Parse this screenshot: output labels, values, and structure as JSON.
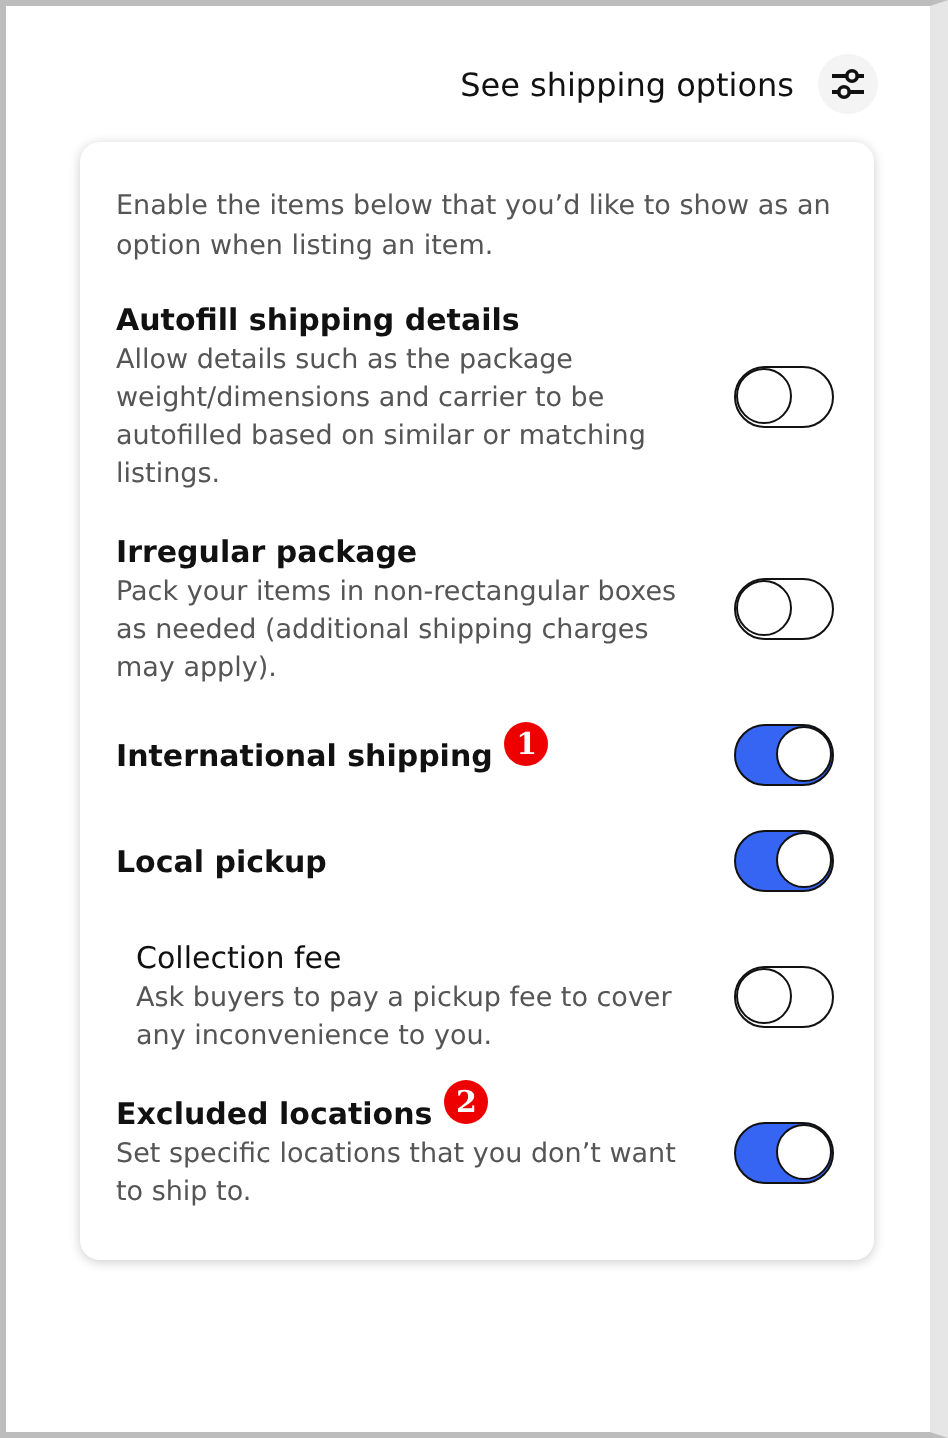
{
  "header": {
    "link": "See shipping options"
  },
  "intro": "Enable the items below that you’d like to show as an option when listing an item.",
  "options": [
    {
      "title": "Autofill shipping details",
      "description": "Allow details such as the package weight/dimensions and carrier to be autofilled based on similar or matching listings.",
      "on": false
    },
    {
      "title": "Irregular package",
      "description": "Pack your items in non-rectangular boxes as needed (additional shipping charges may apply).",
      "on": false
    },
    {
      "title": "International shipping",
      "marker": "1",
      "on": true
    },
    {
      "title": "Local pickup",
      "on": true,
      "children": [
        {
          "title": "Collection fee",
          "description": "Ask buyers to pay a pickup fee to cover any inconvenience to you.",
          "on": false
        }
      ]
    },
    {
      "title": "Excluded locations",
      "marker": "2",
      "description": "Set specific locations that you don’t want to ship to.",
      "on": true
    }
  ]
}
